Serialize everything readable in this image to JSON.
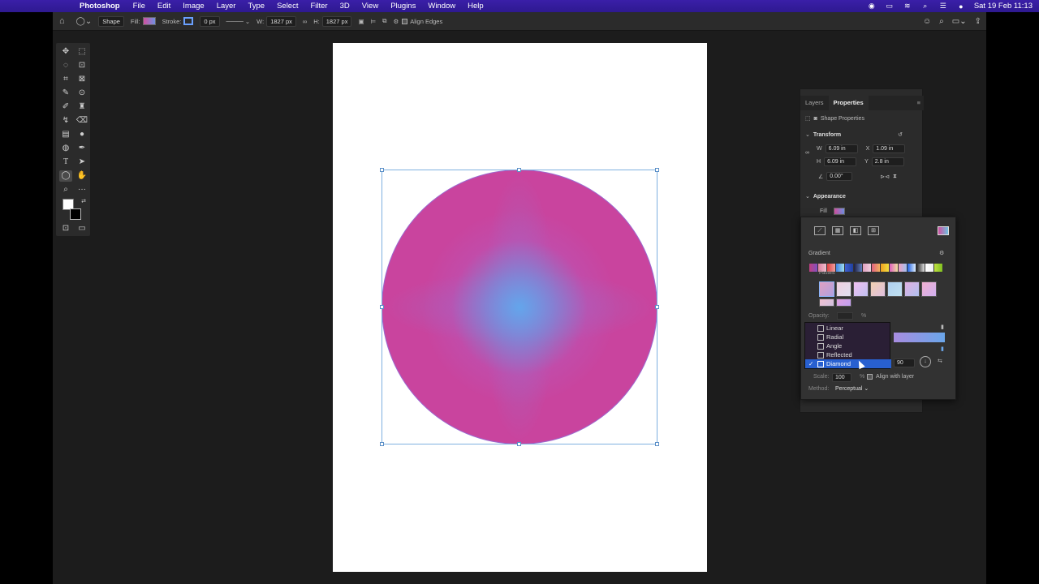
{
  "menubar": {
    "app_name": "Photoshop",
    "items": [
      "File",
      "Edit",
      "Image",
      "Layer",
      "Type",
      "Select",
      "Filter",
      "3D",
      "View",
      "Plugins",
      "Window",
      "Help"
    ],
    "clock": "Sat 19 Feb  11:13"
  },
  "options_bar": {
    "mode": "Shape",
    "fill_label": "Fill:",
    "stroke_label": "Stroke:",
    "stroke_width": "0 px",
    "w_label": "W:",
    "w_value": "1827 px",
    "h_label": "H:",
    "h_value": "1827 px",
    "align_edges": "Align Edges"
  },
  "properties": {
    "tabs": [
      "Layers",
      "Properties"
    ],
    "active_tab": "Properties",
    "subtitle": "Shape Properties",
    "transform_title": "Transform",
    "w_label": "W",
    "w": "6.09 in",
    "x_label": "X",
    "x": "1.09 in",
    "h_label": "H",
    "h": "6.09 in",
    "y_label": "Y",
    "y": "2.8 in",
    "angle": "0.00°",
    "appearance_title": "Appearance",
    "fill_label": "Fill"
  },
  "gradient_popup": {
    "section_title": "Gradient",
    "folder_label": "Pastels",
    "opacity_label": "Opacity:",
    "opacity_unit": "%",
    "angle_value": "90",
    "scale_label": "Scale:",
    "scale_value": "100",
    "scale_unit": "%",
    "align_with_layer": "Align with layer",
    "method_label": "Method:",
    "method_value": "Perceptual"
  },
  "style_dropdown": {
    "options": [
      "Linear",
      "Radial",
      "Angle",
      "Reflected",
      "Diamond"
    ],
    "selected": "Diamond"
  },
  "colors": {
    "menubar": "#3a1fa8",
    "circle_outer": "#c9449e",
    "circle_center": "#64a5eb",
    "selection": "#2860d0"
  }
}
